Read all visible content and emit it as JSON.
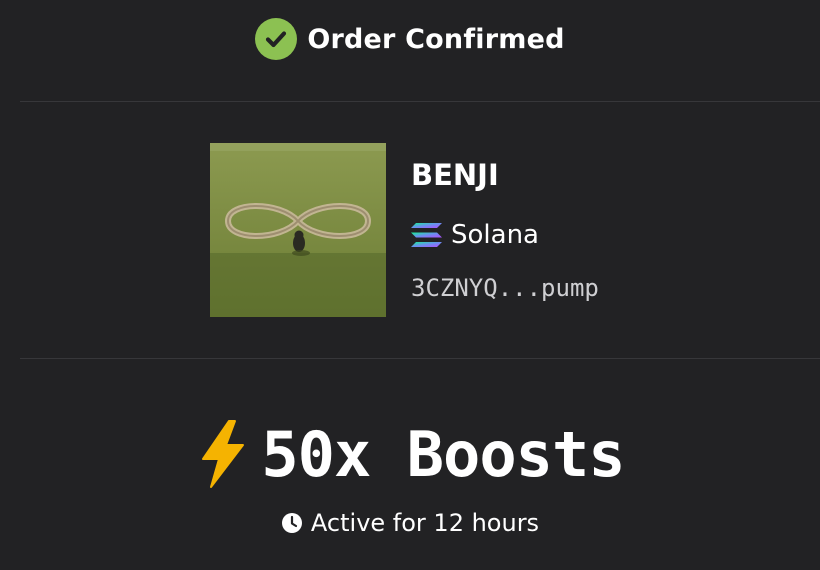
{
  "header": {
    "title": "Order Confirmed",
    "icon": "check-circle-icon",
    "icon_color": "#8cc152"
  },
  "token": {
    "name": "BENJI",
    "chain": "Solana",
    "chain_icon": "solana-icon",
    "address": "3CZNYQ...pump",
    "image": "token-avatar"
  },
  "boost": {
    "label": "50x Boosts",
    "icon": "lightning-bolt-icon",
    "icon_color": "#f5b301",
    "duration": "Active for 12 hours",
    "duration_icon": "clock-icon"
  },
  "colors": {
    "background": "#222224",
    "divider": "#37373a",
    "text": "#ffffff"
  }
}
